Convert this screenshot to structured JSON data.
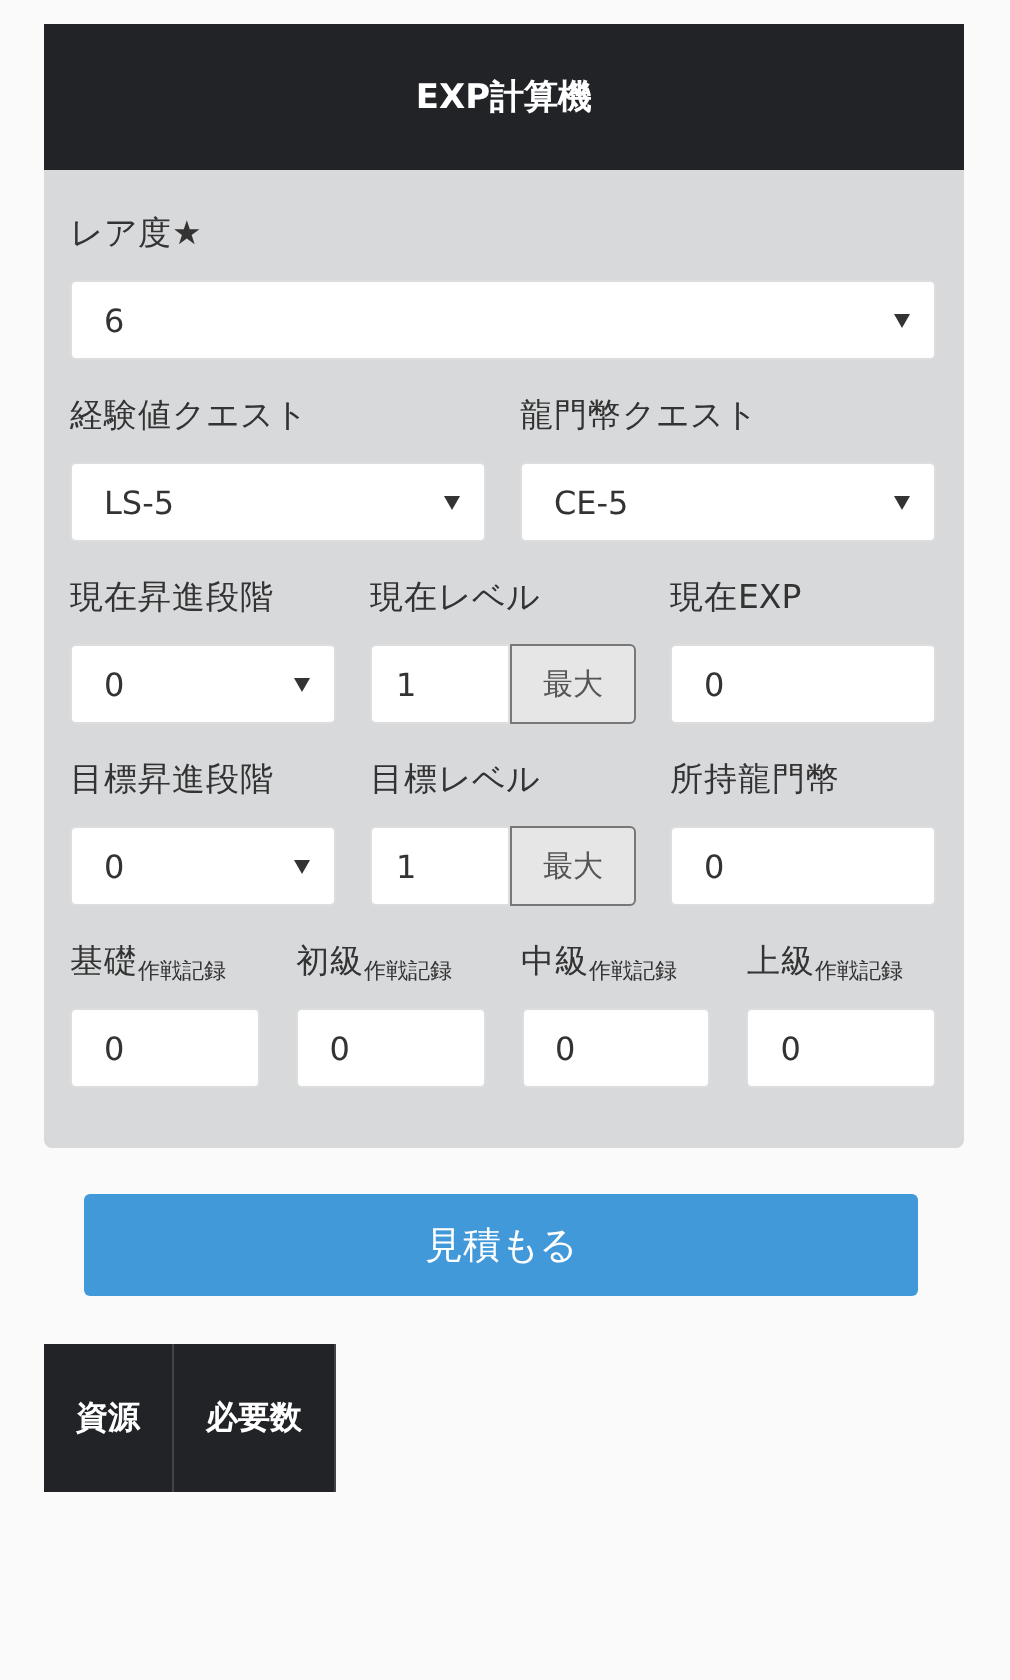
{
  "title": "EXP計算機",
  "rarity": {
    "label": "レア度★",
    "value": "6"
  },
  "quests": [
    {
      "label": "経験値クエスト",
      "value": "LS-5"
    },
    {
      "label": "龍門幣クエスト",
      "value": "CE-5"
    }
  ],
  "current": [
    {
      "kind": "select",
      "label": "現在昇進段階",
      "value": "0"
    },
    {
      "kind": "level",
      "label": "現在レベル",
      "value": "1",
      "button": "最大"
    },
    {
      "kind": "input",
      "label": "現在EXP",
      "value": "0"
    }
  ],
  "target": [
    {
      "kind": "select",
      "label": "目標昇進段階",
      "value": "0"
    },
    {
      "kind": "level",
      "label": "目標レベル",
      "value": "1",
      "button": "最大"
    },
    {
      "kind": "input",
      "label": "所持龍門幣",
      "value": "0"
    }
  ],
  "records": [
    {
      "label": "基礎$_{作戦記録}$",
      "value": "0"
    },
    {
      "label": "初級$_{作戦記録}$",
      "value": "0"
    },
    {
      "label": "中級$_{作戦記録}$",
      "value": "0"
    },
    {
      "label": "上級$_{作戦記録}$",
      "value": "0"
    }
  ],
  "submit": "見積もる",
  "table": {
    "columns": [
      "資源",
      "必要数"
    ]
  }
}
